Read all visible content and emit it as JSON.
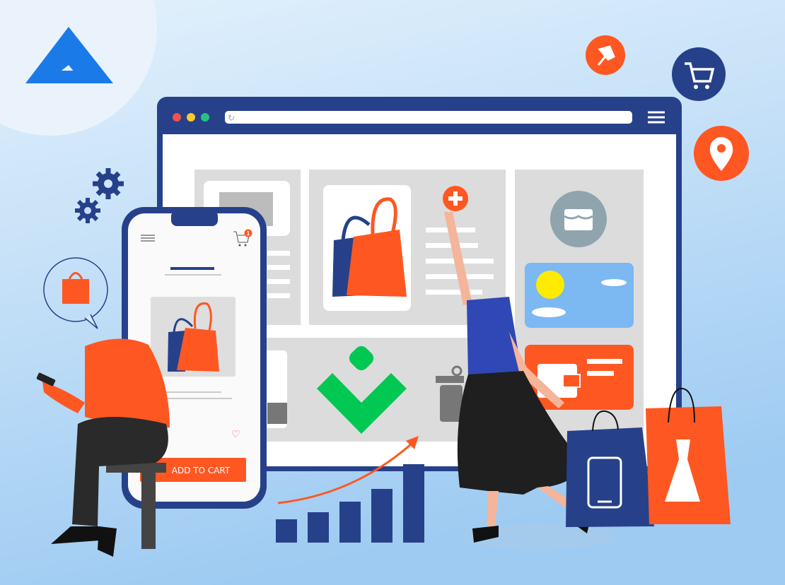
{
  "colors": {
    "navy": "#26418a",
    "orange": "#ff5722",
    "green": "#00c853",
    "logo_blue": "#1a7be8",
    "panel_grey": "#dcdcdc",
    "background_top": "#e3f1fc",
    "background_bottom": "#9ecbf2"
  },
  "phone": {
    "add_to_cart_label": "ADD TO CART",
    "cart_badge_count": "1"
  },
  "icons": [
    "logo",
    "settings-gear",
    "shopping-bag",
    "pin",
    "shopping-cart",
    "location-pin",
    "store",
    "wallet",
    "heart",
    "trash",
    "plus",
    "chevron-down"
  ]
}
